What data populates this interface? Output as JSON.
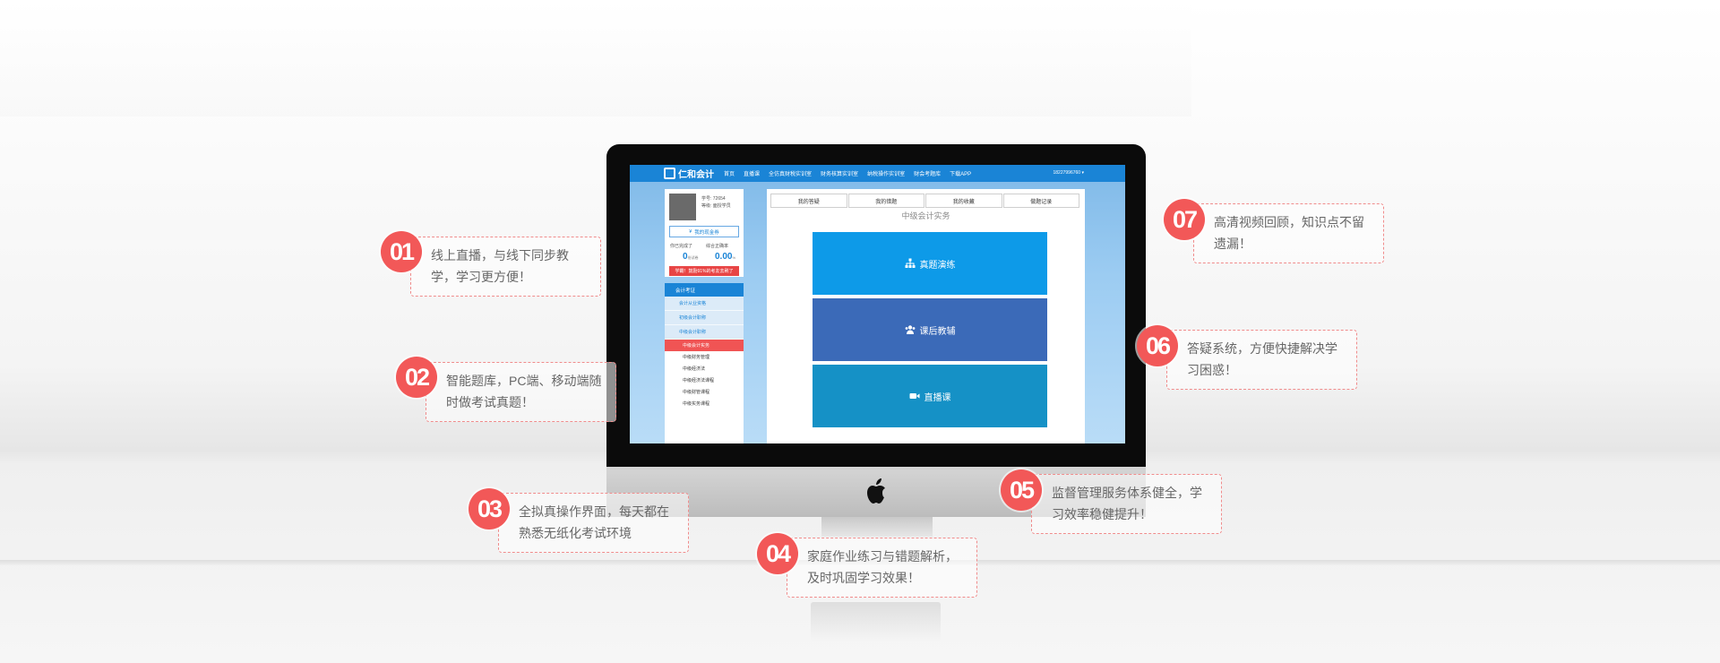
{
  "site": {
    "logo": "仁和会计",
    "nav": [
      "首页",
      "直播课",
      "全仿真财税实训室",
      "财务核算实训室",
      "纳税操作实训室",
      "财会考题库",
      "下载APP"
    ],
    "phone": "18227996760 ▾"
  },
  "user": {
    "id": "学号: 72654",
    "level": "等级: 面授学员",
    "coupon": "我的现金券",
    "stats": [
      {
        "label": "你已完成了",
        "value": "0",
        "unit": "份试卷"
      },
      {
        "label": "综合正确率",
        "value": "0.00",
        "unit": "%"
      }
    ],
    "study_button": "学霸！鼓励91%的考友去刷了"
  },
  "menu": {
    "header": "会计考证",
    "subs": [
      "会计从业资格",
      "初级会计职称",
      "中级会计职称"
    ],
    "active": "中级会计实务",
    "leaves": [
      "中级财务管理",
      "中级经济法",
      "中级经济法课程",
      "中级财管课程",
      "中级实务课程"
    ]
  },
  "main": {
    "tabs": [
      "我的答疑",
      "我的错题",
      "我的收藏",
      "做题记录"
    ],
    "subject": "中级会计实务",
    "tiles": [
      {
        "label": "真题演练",
        "color": "#0d9ae8",
        "icon": "sitemap-icon"
      },
      {
        "label": "课后教辅",
        "color": "#3b6ab8",
        "icon": "users-icon"
      },
      {
        "label": "直播课",
        "color": "#1591c6",
        "icon": "video-icon"
      }
    ]
  },
  "features": [
    {
      "num": "01",
      "text": "线上直播，与线下同步教学，学习更方便！"
    },
    {
      "num": "02",
      "text": "智能题库，PC端、移动端随时做考试真题！"
    },
    {
      "num": "03",
      "text": "全拟真操作界面，每天都在熟悉无纸化考试环境"
    },
    {
      "num": "04",
      "text": "家庭作业练习与错题解析，及时巩固学习效果！"
    },
    {
      "num": "05",
      "text": "监督管理服务体系健全，学习效率稳健提升！"
    },
    {
      "num": "06",
      "text": "答疑系统，方便快捷解决学习困惑！"
    },
    {
      "num": "07",
      "text": "高清视频回顾，知识点不留遗漏！"
    }
  ],
  "colors": {
    "accent": "#f25858",
    "brand": "#1a84d6"
  }
}
